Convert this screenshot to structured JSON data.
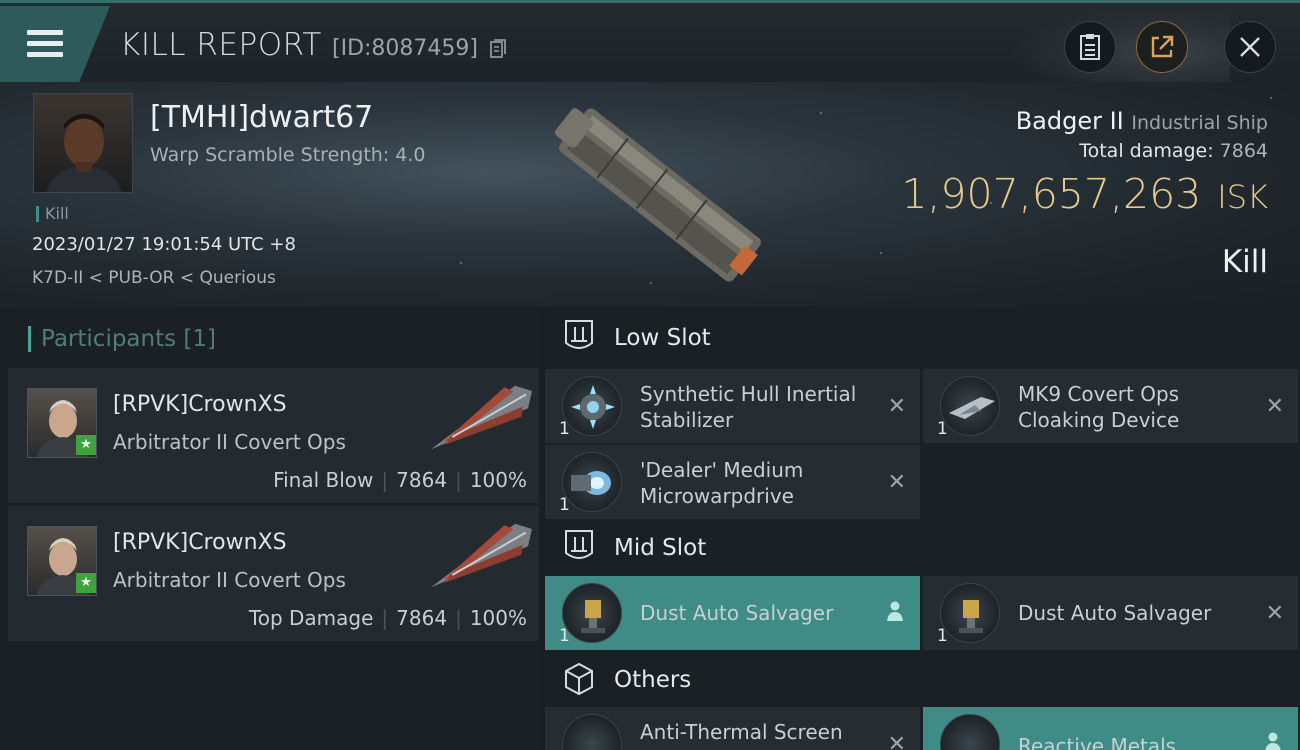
{
  "topbar": {
    "title": "KILL REPORT",
    "report_id": "[ID:8087459]"
  },
  "victim": {
    "name": "[TMHI]dwart67",
    "warp_scramble": "Warp Scramble Strength: 4.0",
    "kill_tag": "Kill",
    "datetime": "2023/01/27 19:01:54 UTC +8",
    "location": "K7D-II < PUB-OR < Querious",
    "ship": "Badger II",
    "ship_class": "Industrial Ship",
    "total_damage_label": "Total damage:",
    "total_damage": "7864",
    "isk_value": "1,907,657,263",
    "isk_unit": "ISK",
    "result": "Kill"
  },
  "participants": {
    "header": "Participants [1]",
    "items": [
      {
        "name": "[RPVK]CrownXS",
        "ship": "Arbitrator II Covert Ops",
        "role": "Final Blow",
        "damage": "7864",
        "percent": "100%"
      },
      {
        "name": "[RPVK]CrownXS",
        "ship": "Arbitrator II Covert Ops",
        "role": "Top Damage",
        "damage": "7864",
        "percent": "100%"
      }
    ]
  },
  "slots": {
    "low": {
      "title": "Low Slot",
      "modules": [
        {
          "name": "Synthetic Hull Inertial Stabilizer",
          "qty": "1"
        },
        {
          "name": "MK9 Covert Ops Cloaking Device",
          "qty": "1"
        },
        {
          "name": "'Dealer' Medium Microwarpdrive",
          "qty": "1"
        }
      ]
    },
    "mid": {
      "title": "Mid Slot",
      "modules": [
        {
          "name": "Dust Auto Salvager",
          "qty": "1"
        },
        {
          "name": "Dust Auto Salvager",
          "qty": "1"
        }
      ]
    },
    "others": {
      "title": "Others",
      "modules": [
        {
          "name": "Anti-Thermal Screen"
        },
        {
          "name": "Reactive Metals"
        }
      ]
    }
  },
  "colors": {
    "accent_teal": "#3f8c86",
    "isk_gold": "#e7c98e",
    "friendly_star": "#3da43c"
  }
}
